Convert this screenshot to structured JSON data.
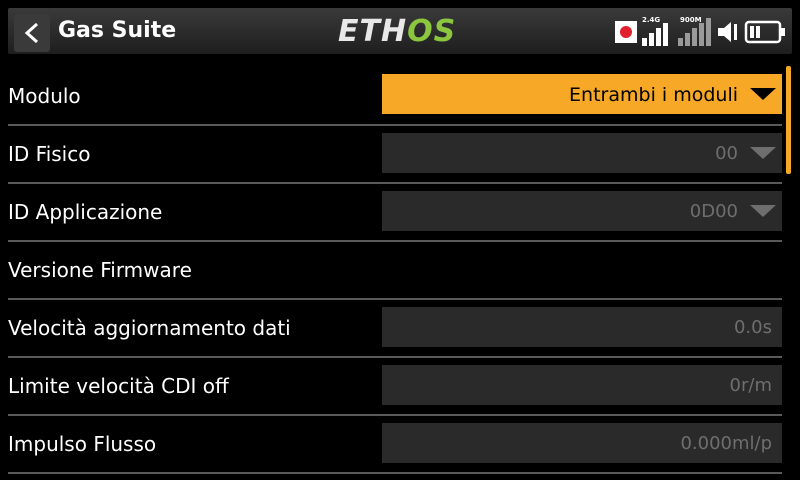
{
  "header": {
    "title": "Gas Suite",
    "logo_part1": "ETH",
    "logo_part2": "OS",
    "signal_24_label": "2.4G",
    "signal_900_label": "900M"
  },
  "rows": [
    {
      "label": "Modulo",
      "value": "Entrambi i moduli",
      "type": "dropdown",
      "active": true
    },
    {
      "label": "ID Fisico",
      "value": "00",
      "type": "dropdown"
    },
    {
      "label": "ID Applicazione",
      "value": "0D00",
      "type": "dropdown"
    },
    {
      "label": "Versione Firmware",
      "value": "",
      "type": "none"
    },
    {
      "label": "Velocità aggiornamento dati",
      "value": "0.0s",
      "type": "number"
    },
    {
      "label": "Limite velocità CDI off",
      "value": "0r/m",
      "type": "number"
    },
    {
      "label": "Impulso Flusso",
      "value": "0.000ml/p",
      "type": "number"
    }
  ],
  "colors": {
    "accent": "#f6a826",
    "field_bg": "#2a2a2a",
    "logo_green": "#8cc63f"
  }
}
